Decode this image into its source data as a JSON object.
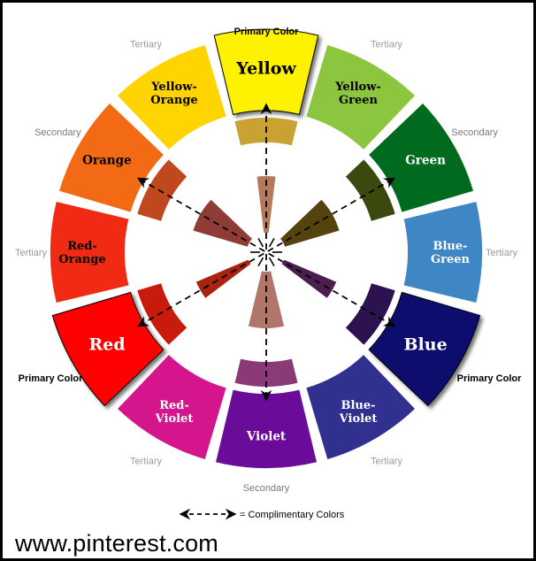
{
  "wheel": {
    "segments": [
      {
        "name": "yellow",
        "label": "Yellow",
        "type": "primary",
        "outer": "#FFF200",
        "mid": "#C9A233",
        "inner": "#B57A5C",
        "text_color": "#000000"
      },
      {
        "name": "yellow-green",
        "label": "Yellow-Green",
        "type": "tertiary",
        "outer": "#8CC63F",
        "mid": null,
        "inner": null,
        "text_color": "#000000"
      },
      {
        "name": "green",
        "label": "Green",
        "type": "secondary",
        "outer": "#006B1F",
        "mid": "#3A4A0E",
        "inner": "#54420F",
        "text_color": "#FFFFFF"
      },
      {
        "name": "blue-green",
        "label": "Blue-Green",
        "type": "tertiary",
        "outer": "#3F87C4",
        "mid": null,
        "inner": null,
        "text_color": "#FFFFFF"
      },
      {
        "name": "blue",
        "label": "Blue",
        "type": "primary",
        "outer": "#0A0A6E",
        "mid": "#2D1250",
        "inner": "#4B1E50",
        "text_color": "#FFFFFF"
      },
      {
        "name": "blue-violet",
        "label": "Blue-Violet",
        "type": "tertiary",
        "outer": "#30308F",
        "mid": null,
        "inner": null,
        "text_color": "#FFFFFF"
      },
      {
        "name": "violet",
        "label": "Violet",
        "type": "secondary",
        "outer": "#6A0B9A",
        "mid": "#8B3A78",
        "inner": "#B0766A",
        "text_color": "#FFFFFF"
      },
      {
        "name": "red-violet",
        "label": "Red-Violet",
        "type": "tertiary",
        "outer": "#D4158C",
        "mid": null,
        "inner": null,
        "text_color": "#FFFFFF"
      },
      {
        "name": "red",
        "label": "Red",
        "type": "primary",
        "outer": "#FF0000",
        "mid": "#C81B0B",
        "inner": "#A8240E",
        "text_color": "#FFFFFF"
      },
      {
        "name": "red-orange",
        "label": "Red-Orange",
        "type": "tertiary",
        "outer": "#F02A13",
        "mid": null,
        "inner": null,
        "text_color": "#000000"
      },
      {
        "name": "orange",
        "label": "Orange",
        "type": "secondary",
        "outer": "#F26A14",
        "mid": "#C0481E",
        "inner": "#8F3B36",
        "text_color": "#000000"
      },
      {
        "name": "yellow-orange",
        "label": "Yellow-Orange",
        "type": "tertiary",
        "outer": "#FFD400",
        "mid": null,
        "inner": null,
        "text_color": "#000000"
      }
    ],
    "outer_labels": [
      {
        "name": "label-primary-yellow",
        "text": "Primary Color",
        "kind": "primary"
      },
      {
        "name": "label-tertiary-yellow-green",
        "text": "Tertiary",
        "kind": "tertiary"
      },
      {
        "name": "label-secondary-green",
        "text": "Secondary",
        "kind": "secondary"
      },
      {
        "name": "label-tertiary-blue-green",
        "text": "Tertiary",
        "kind": "tertiary"
      },
      {
        "name": "label-primary-blue",
        "text": "Primary Color",
        "kind": "primary"
      },
      {
        "name": "label-tertiary-blue-violet",
        "text": "Tertiary",
        "kind": "tertiary"
      },
      {
        "name": "label-secondary-violet",
        "text": "Secondary",
        "kind": "secondary"
      },
      {
        "name": "label-tertiary-red-violet",
        "text": "Tertiary",
        "kind": "tertiary"
      },
      {
        "name": "label-primary-red",
        "text": "Primary Color",
        "kind": "primary"
      },
      {
        "name": "label-tertiary-red-orange",
        "text": "Tertiary",
        "kind": "tertiary"
      },
      {
        "name": "label-secondary-orange",
        "text": "Secondary",
        "kind": "secondary"
      },
      {
        "name": "label-tertiary-yellow-orange",
        "text": "Tertiary",
        "kind": "tertiary"
      }
    ],
    "complementary_pairs": [
      [
        "yellow",
        "violet"
      ],
      [
        "red",
        "green"
      ],
      [
        "blue",
        "orange"
      ]
    ],
    "legend": {
      "symbol": "← - - →",
      "text": "= Complimentary Colors"
    },
    "colors": {
      "primary_label": "#000000",
      "secondary_label": "#7A7A7A",
      "tertiary_label": "#9A9A9A",
      "arrow": "#000000"
    }
  },
  "watermark": "www.pinterest.com"
}
